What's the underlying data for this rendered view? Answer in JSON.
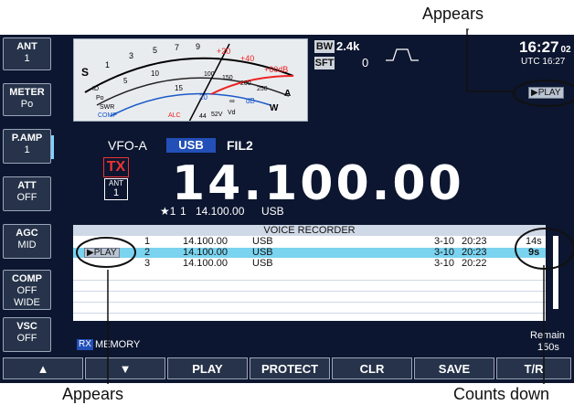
{
  "callouts": {
    "top": "Appears",
    "bottom_left": "Appears",
    "bottom_right": "Counts down"
  },
  "side_buttons": [
    {
      "title": "ANT",
      "value": "1"
    },
    {
      "title": "METER",
      "value": "Po"
    },
    {
      "title": "P.AMP",
      "value": "1"
    },
    {
      "title": "ATT",
      "value": "OFF"
    },
    {
      "title": "AGC",
      "value": "MID"
    },
    {
      "title": "COMP",
      "value": "OFF",
      "value2": "WIDE"
    },
    {
      "title": "VSC",
      "value": "OFF"
    }
  ],
  "meter": {
    "s_label": "S",
    "db_label": "+60dB",
    "plus20": "+20",
    "plus40": "+40",
    "a_label": "A",
    "w_label": "W",
    "swr": "SWR",
    "comp": "COMP",
    "alc": "ALC",
    "vd": "Vd",
    "id": "ID",
    "po": "Po",
    "s_ticks": [
      "1",
      "3",
      "5",
      "7",
      "9"
    ],
    "other": [
      "5",
      "10",
      "15",
      "20",
      "44",
      "52V",
      "∞",
      "dB",
      "100",
      "150",
      "200",
      "250"
    ]
  },
  "status": {
    "bw_label": "BW",
    "bw_value": "2.4k",
    "sft_label": "SFT",
    "sft_value": "0",
    "clock": "16:27",
    "clock_sec": "02",
    "utc": "UTC 16:27",
    "play_badge": "▶PLAY"
  },
  "vfo": {
    "name": "VFO-A",
    "mode": "USB",
    "filter": "FIL2",
    "tx": "TX",
    "ant_label": "ANT",
    "ant_value": "1",
    "frequency": "14.100.00",
    "sub_star": "★1",
    "sub_num": "1",
    "sub_freq": "14.100.00",
    "sub_mode": "USB"
  },
  "voice_recorder": {
    "title": "VOICE RECORDER",
    "rows": [
      {
        "num": "1",
        "freq": "14.100.00",
        "mode": "USB",
        "date": "3-10",
        "time": "20:23",
        "dur": "14s"
      },
      {
        "num": "2",
        "freq": "14.100.00",
        "mode": "USB",
        "date": "3-10",
        "time": "20:23",
        "dur": "9s"
      },
      {
        "num": "3",
        "freq": "14.100.00",
        "mode": "USB",
        "date": "3-10",
        "time": "20:22",
        "dur": ""
      }
    ],
    "play_badge": "▶PLAY",
    "rx_label": "RX",
    "memory_label": "MEMORY",
    "remain_label": "Remain",
    "remain_value": "150s"
  },
  "bottom_buttons": [
    "▲",
    "▼",
    "PLAY",
    "PROTECT",
    "CLR",
    "SAVE",
    "T/R"
  ]
}
